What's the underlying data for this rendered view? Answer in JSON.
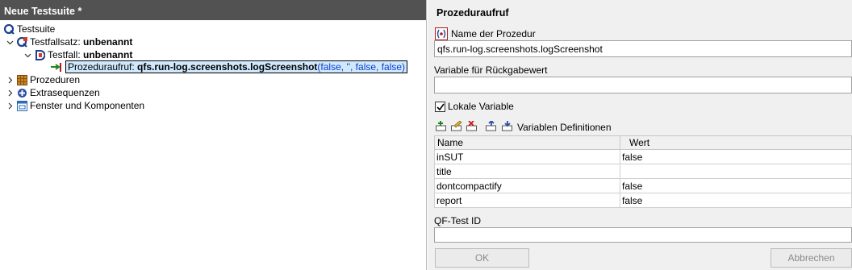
{
  "left_panel": {
    "title": "Neue Testsuite *",
    "tree": {
      "root_label": "Testsuite",
      "testfallsatz_prefix": "Testfallsatz: ",
      "testfallsatz_name": "unbenannt",
      "testfall_prefix": "Testfall: ",
      "testfall_name": "unbenannt",
      "call_prefix": "Prozeduraufruf: ",
      "call_name": "qfs.run-log.screenshots.logScreenshot",
      "call_args": "(false, '', false, false)",
      "prozeduren": "Prozeduren",
      "extrasequenzen": "Extrasequenzen",
      "fenster": "Fenster und Komponenten"
    }
  },
  "right_panel": {
    "title": "Prozeduraufruf",
    "name_label": "Name der Prozedur",
    "name_value": "qfs.run-log.screenshots.logScreenshot",
    "return_label": "Variable für Rückgabewert",
    "return_value": "",
    "local_label": "Lokale Variable",
    "local_checked": true,
    "vars_label": "Variablen Definitionen",
    "table": {
      "headers": [
        "Name",
        "Wert"
      ],
      "rows": [
        [
          "inSUT",
          "false"
        ],
        [
          "title",
          ""
        ],
        [
          "dontcompactify",
          "false"
        ],
        [
          "report",
          "false"
        ]
      ]
    },
    "id_label": "QF-Test ID",
    "id_value": "",
    "ok_label": "OK",
    "cancel_label": "Abbrechen"
  },
  "colors": {
    "title_bar": "#525252",
    "selection": "#cfe8fc",
    "args_blue": "#0a3ccd"
  }
}
